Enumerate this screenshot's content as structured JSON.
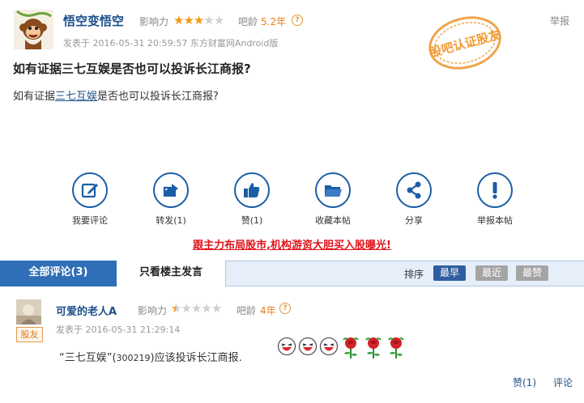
{
  "post": {
    "author": "悟空变悟空",
    "influence_label": "影响力",
    "influence_stars": 3,
    "age_label": "吧龄",
    "age_value": "5.2年",
    "help": "?",
    "report": "举报",
    "meta": "发表于 2016-05-31 20:59:57 东方财富网Android版",
    "title": "如有证据三七互娱是否也可以投诉长江商报?",
    "body_before": "如有证据",
    "body_link": "三七互娱",
    "body_after": "是否也可以投诉长江商报?",
    "stamp_text": "股吧认证股友"
  },
  "actions": [
    {
      "label": "我要评论",
      "icon": "comment-edit-icon"
    },
    {
      "label": "转发(1)",
      "icon": "share-forward-icon"
    },
    {
      "label": "赞(1)",
      "icon": "thumbs-up-icon"
    },
    {
      "label": "收藏本帖",
      "icon": "folder-icon"
    },
    {
      "label": "分享",
      "icon": "share-nodes-icon"
    },
    {
      "label": "举报本帖",
      "icon": "exclamation-icon"
    }
  ],
  "promo": "跟主力布局股市,机构游资大胆买入股曝光!",
  "tabs": {
    "all": "全部评论(3)",
    "host_only": "只看楼主发言",
    "sort_label": "排序",
    "sort_options": [
      "最早",
      "最近",
      "最赞"
    ],
    "active_sort": "最早"
  },
  "comment": {
    "author": "可爱的老人A",
    "badge": "股友",
    "influence_label": "影响力",
    "influence_stars": 0.5,
    "age_label": "吧龄",
    "age_value": "4年",
    "help": "?",
    "meta": "发表于 2016-05-31 21:29:14",
    "body_prefix": "“三七互娱”(",
    "body_code": "300219",
    "body_suffix": ")应该投诉长江商报.",
    "emojis": [
      "laughing-face-icon",
      "laughing-face-icon",
      "laughing-face-icon",
      "rose-icon",
      "rose-icon",
      "rose-icon"
    ],
    "like": "赞(1)",
    "reply": "评论"
  },
  "colors": {
    "link_blue": "#1d4f8a",
    "icon_blue": "#1c5ea6",
    "star_orange": "#f39a12",
    "promo_red": "#e1131a",
    "tab_active": "#2f6fb7"
  }
}
